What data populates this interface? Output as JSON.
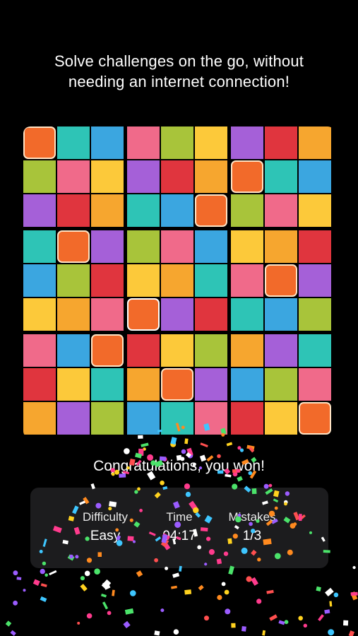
{
  "headline": {
    "line1": "Solve challenges on the go, without",
    "line2": "needing an internet connection!"
  },
  "board": {
    "palette": {
      "O": "#f26a2a",
      "T": "#2ec4b6",
      "B": "#3ba6e0",
      "P": "#f06a8a",
      "L": "#a8c43a",
      "Y": "#fcc93a",
      "V": "#a560d8",
      "R": "#e0353e",
      "A": "#f6a62f"
    },
    "highlight_color": "#f26a2a",
    "rows": [
      "OTBPLYVRA",
      "LPYVRAOTB",
      "VRATBOLPY",
      "TOVLPBYAR",
      "BLRYATPOV",
      "YAPOVRTBL",
      "PBOR​YLAVT",
      "RYTAOVBLP",
      "AVLBTPRYO"
    ],
    "highlighted": [
      [
        0,
        0
      ],
      [
        1,
        6
      ],
      [
        2,
        5
      ],
      [
        3,
        1
      ],
      [
        4,
        7
      ],
      [
        5,
        3
      ],
      [
        6,
        2
      ],
      [
        7,
        4
      ],
      [
        8,
        8
      ]
    ],
    "selected": [
      5,
      3
    ]
  },
  "result": {
    "message": "Congratulations, you won!"
  },
  "stats": {
    "difficulty_label": "Difficulty",
    "difficulty_value": "Easy",
    "time_label": "Time",
    "time_value": "04:17",
    "mistakes_label": "Mistakes",
    "mistakes_value": "1/3"
  },
  "confetti_colors": [
    "#ff3b8d",
    "#ffd21f",
    "#3ec6ff",
    "#9b5cff",
    "#ff8a1f",
    "#4be36a",
    "#ff4f4f",
    "#ffffff"
  ]
}
